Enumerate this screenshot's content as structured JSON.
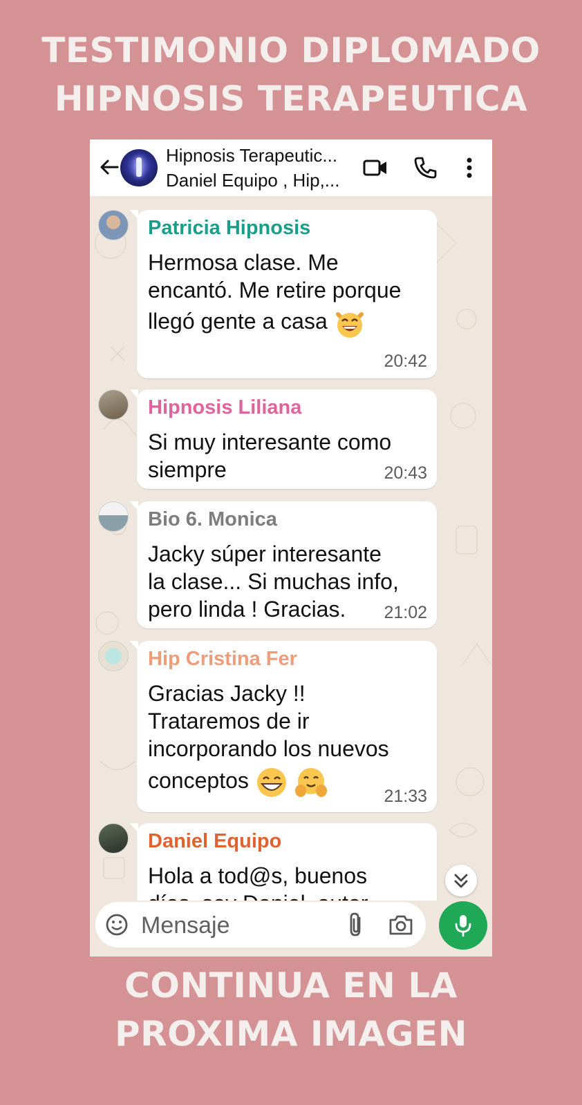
{
  "top_title": {
    "line1": "TESTIMONIO DIPLOMADO",
    "line2": "HIPNOSIS TERAPEUTICA"
  },
  "bottom_title": {
    "line1": "CONTINUA EN LA",
    "line2": "PROXIMA IMAGEN"
  },
  "header": {
    "title": "Hipnosis Terapeutic...",
    "subtitle": "Daniel Equipo , Hip,...",
    "icons": [
      "back-arrow-icon",
      "video-call-icon",
      "phone-icon",
      "more-vert-icon"
    ]
  },
  "messages": [
    {
      "sender": "Patricia Hipnosis",
      "sender_color": "#1a9e8a",
      "lines": [
        "Hermosa clase. Me",
        "encantó. Me retire porque",
        "llegó gente a casa"
      ],
      "emoji": [
        "grinning-cat-emoji"
      ],
      "time": "20:42"
    },
    {
      "sender": "Hipnosis Liliana",
      "sender_color": "#e0639b",
      "lines": [
        "Si muy interesante como",
        "siempre"
      ],
      "time": "20:43"
    },
    {
      "sender": "Bio 6. Monica",
      "sender_color": "#7d7d7d",
      "lines": [
        "Jacky súper interesante",
        "la clase... Si muchas info,",
        "pero linda ! Gracias."
      ],
      "time": "21:02"
    },
    {
      "sender": "Hip Cristina Fer",
      "sender_color": "#ee9d7c",
      "lines": [
        "Gracias Jacky !!",
        "Trataremos de ir",
        "incorporando los nuevos",
        "conceptos"
      ],
      "emoji": [
        "grinning-emoji",
        "hugging-emoji"
      ],
      "time": "21:33"
    },
    {
      "sender": "Daniel Equipo",
      "sender_color": "#e2622f",
      "lines": [
        "Hola a tod@s, buenos",
        "días, soy Daniel, autor"
      ]
    }
  ],
  "composer": {
    "placeholder": "Mensaje"
  },
  "colors": {
    "background": "#d59294",
    "title_text": "#f4efed",
    "mic_button": "#1fa855"
  }
}
